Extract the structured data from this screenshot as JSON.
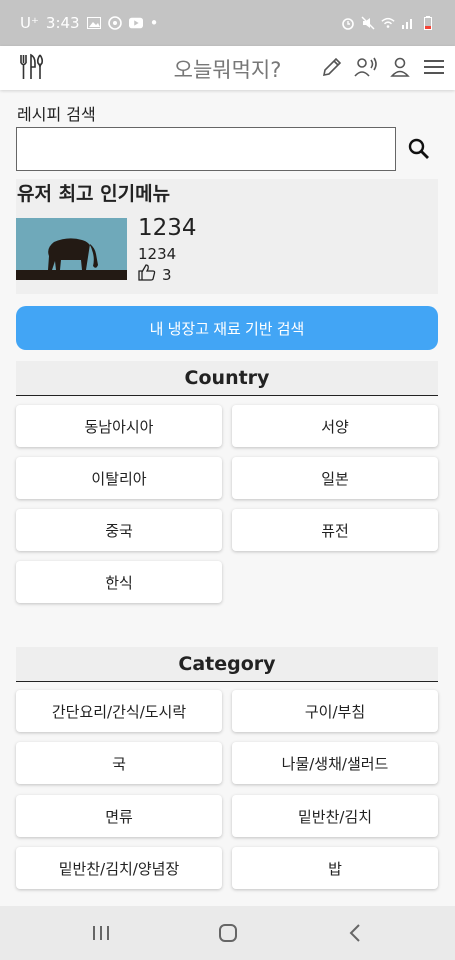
{
  "status_bar": {
    "carrier": "U⁺",
    "time": "3:43",
    "dot": "•"
  },
  "header": {
    "title": "오늘뭐먹지?",
    "icons": [
      "utensils-icon",
      "pencil-icon",
      "voice-icon",
      "user-icon",
      "menu-icon"
    ]
  },
  "search": {
    "label": "레시피 검색",
    "value": "",
    "placeholder": ""
  },
  "popular": {
    "title": "유저 최고 인기메뉴",
    "name": "1234",
    "subtitle": "1234",
    "likes": "3"
  },
  "fridge_button": "내 냉장고 재료 기반 검색",
  "country": {
    "header": "Country",
    "items": [
      "동남아시아",
      "서양",
      "이탈리아",
      "일본",
      "중국",
      "퓨전",
      "한식"
    ]
  },
  "category": {
    "header": "Category",
    "items": [
      "간단요리/간식/도시락",
      "구이/부침",
      "국",
      "나물/생채/샐러드",
      "면류",
      "밑반찬/김치",
      "밑반찬/김치/양념장",
      "밥"
    ]
  },
  "colors": {
    "accent": "#42a5f5",
    "status_bar": "#c4c4c4",
    "background": "#f7f7f7"
  }
}
